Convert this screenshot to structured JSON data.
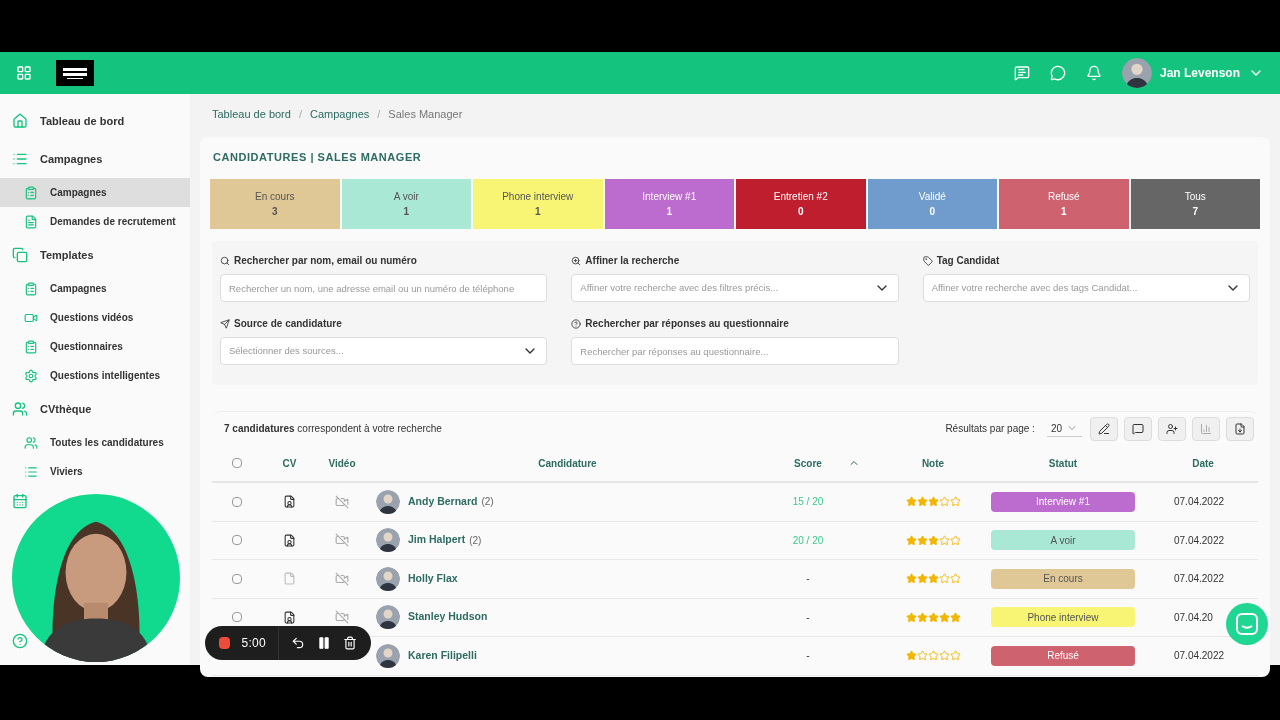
{
  "header": {
    "user_name": "Jan Levenson"
  },
  "sidebar": {
    "items": [
      {
        "label": "Tableau de bord",
        "selected": false
      },
      {
        "label": "Campagnes",
        "selected": false,
        "children": [
          {
            "label": "Campagnes",
            "selected": true
          },
          {
            "label": "Demandes de recrutement",
            "selected": false
          }
        ]
      },
      {
        "label": "Templates",
        "selected": false,
        "children": [
          {
            "label": "Campagnes",
            "selected": false
          },
          {
            "label": "Questions vidéos",
            "selected": false
          },
          {
            "label": "Questionnaires",
            "selected": false
          },
          {
            "label": "Questions intelligentes",
            "selected": false
          }
        ]
      },
      {
        "label": "CVthèque",
        "selected": false,
        "children": [
          {
            "label": "Toutes les candidatures",
            "selected": false
          },
          {
            "label": "Viviers",
            "selected": false
          }
        ]
      }
    ]
  },
  "breadcrumb": {
    "items": [
      "Tableau de bord",
      "Campagnes",
      "Sales Manager"
    ],
    "separator": "/"
  },
  "card_title": "CANDIDATURES | SALES MANAGER",
  "status_tiles": [
    {
      "label": "En cours",
      "count": "3",
      "color": "#dfc896"
    },
    {
      "label": "A voir",
      "count": "1",
      "color": "#a8e8d4"
    },
    {
      "label": "Phone interview",
      "count": "1",
      "color": "#f8f574"
    },
    {
      "label": "Interview #1",
      "count": "1",
      "color": "#bc6ccf"
    },
    {
      "label": "Entretien #2",
      "count": "0",
      "color": "#be1e2d"
    },
    {
      "label": "Validé",
      "count": "0",
      "color": "#6f9ccc"
    },
    {
      "label": "Refusé",
      "count": "1",
      "color": "#cf626f"
    },
    {
      "label": "Tous",
      "count": "7",
      "color": "#666666"
    }
  ],
  "filters": [
    {
      "label": "Rechercher par nom, email ou numéro",
      "kind": "input",
      "placeholder": "Rechercher un nom, une adresse email ou un numéro de téléphone"
    },
    {
      "label": "Affiner la recherche",
      "kind": "select",
      "placeholder": "Affiner votre recherche avec des filtres précis..."
    },
    {
      "label": "Tag Candidat",
      "kind": "select",
      "placeholder": "Affiner votre recherche avec des tags Candidat..."
    },
    {
      "label": "Source de candidature",
      "kind": "select",
      "placeholder": "Sélectionner des sources..."
    },
    {
      "label": "Rechercher par réponses au questionnaire",
      "kind": "input",
      "placeholder": "Rechercher par réponses au questionnaire..."
    }
  ],
  "results": {
    "summary": "**7 candidatures** correspondent à votre recherche",
    "per_page_label": "Résultats par page :",
    "per_page": "20"
  },
  "table": {
    "all_checked": false,
    "columns": [
      "CV",
      "Vidéo",
      "Candidature",
      "Score",
      "Note",
      "Statut",
      "Date"
    ],
    "rows": [
      {
        "checked": false,
        "name": "Andy Bernard",
        "count": "(2)",
        "has_cv": true,
        "score": "15 / 20",
        "stars": 3,
        "status": "Interview #1",
        "color": "#bc6ccf",
        "date": "07.04.2022"
      },
      {
        "checked": false,
        "name": "Jim Halpert",
        "count": "(2)",
        "has_cv": true,
        "score": "20 / 20",
        "stars": 3,
        "status": "A voir",
        "color": "#a8e8d4",
        "date": "07.04.2022"
      },
      {
        "checked": false,
        "name": "Holly Flax",
        "has_cv": false,
        "score": "-",
        "stars": 3,
        "status": "En cours",
        "color": "#dfc896",
        "date": "07.04.2022"
      },
      {
        "checked": false,
        "name": "Stanley Hudson",
        "has_cv": true,
        "score": "-",
        "stars": 5,
        "status": "Phone interview",
        "color": "#f8f574",
        "date": "07.04.20"
      },
      {
        "name": "Karen Filipelli",
        "score": "-",
        "stars": 1,
        "status": "Refusé",
        "color": "#cf626f",
        "date": "07.04.2022"
      }
    ]
  },
  "recorder": {
    "time": "5:00"
  }
}
